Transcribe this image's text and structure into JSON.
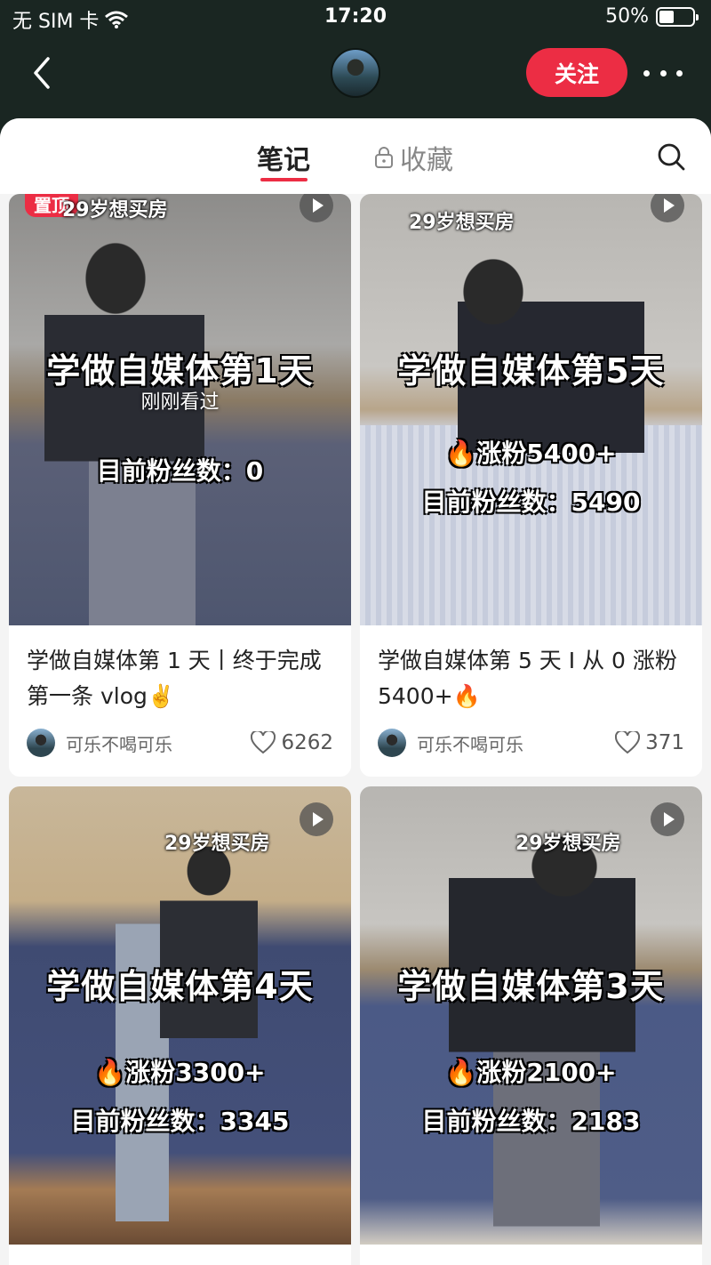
{
  "status_bar": {
    "carrier": "无 SIM 卡",
    "time": "17:20",
    "battery": "50%"
  },
  "header": {
    "follow_label": "关注"
  },
  "tabs": {
    "notes": "笔记",
    "favorites": "收藏"
  },
  "notes": [
    {
      "pinned_label": "置顶",
      "tag": "29岁想买房",
      "headline": "学做自媒体第1天",
      "seen_label": "刚刚看过",
      "sub1": "",
      "sub2": "目前粉丝数：0",
      "title": "学做自媒体第 1 天丨终于完成第一条 vlog✌️",
      "author": "可乐不喝可乐",
      "likes": "6262"
    },
    {
      "tag": "29岁想买房",
      "headline": "学做自媒体第5天",
      "sub1": "🔥涨粉5400+",
      "sub2": "目前粉丝数：5490",
      "title": "学做自媒体第 5 天 I 从 0 涨粉 5400+🔥",
      "author": "可乐不喝可乐",
      "likes": "371"
    },
    {
      "tag": "29岁想买房",
      "headline": "学做自媒体第4天",
      "sub1": "🔥涨粉3300+",
      "sub2": "目前粉丝数：3345"
    },
    {
      "tag": "29岁想买房",
      "headline": "学做自媒体第3天",
      "sub1": "🔥涨粉2100+",
      "sub2": "目前粉丝数：2183"
    }
  ]
}
